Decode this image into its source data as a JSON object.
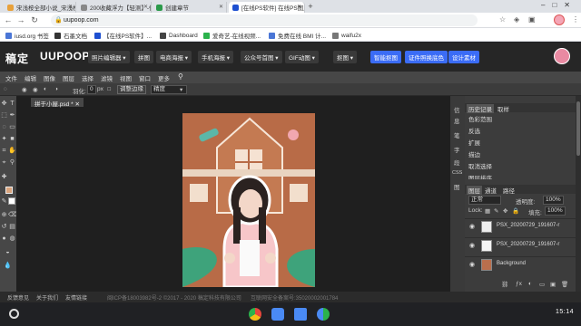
{
  "browser": {
    "tabs": [
      {
        "title": "宋浅桉全部小说_宋浅桉作品全集",
        "favicon_color": "#e8a13a"
      },
      {
        "title": "200收藏浮力【轻测】-他免…",
        "favicon_color": "#888888"
      },
      {
        "title": "创建章节",
        "favicon_color": "#2b9a4a"
      },
      {
        "title": "[在线PS软件] 在线PS图片",
        "favicon_color": "#1d4fd0",
        "active": true
      }
    ],
    "new_tab": "+",
    "url": "uupoop.com",
    "bookmarks": [
      {
        "label": "iusd.org 书签",
        "color": "#4a76d6"
      },
      {
        "label": "石墨文档",
        "color": "#333333"
      },
      {
        "label": "【在线PS软件】...",
        "color": "#1d4fd0"
      },
      {
        "label": "Dashboard",
        "color": "#444444"
      },
      {
        "label": "爱奇艺-在线视频...",
        "color": "#2bb24c"
      },
      {
        "label": "免费在线 BMI 计...",
        "color": "#4a76d6"
      },
      {
        "label": "waifu2x",
        "color": "#777777"
      }
    ]
  },
  "app": {
    "logo_cn": "稿定",
    "logo_en": "UUPOOP",
    "nav": [
      {
        "label": "照片编辑器 ▾",
        "style": "dark"
      },
      {
        "label": "拼图",
        "style": "dark"
      },
      {
        "label": "电商海报 ▾",
        "style": "dark"
      },
      {
        "label": "手机海报 ▾",
        "style": "dark"
      },
      {
        "label": "公众号首图 ▾",
        "style": "dark"
      },
      {
        "label": "GIF动图 ▾",
        "style": "dark"
      },
      {
        "label": "抠图 ▾",
        "style": "dark"
      },
      {
        "label": "智能抠图",
        "style": "blue"
      },
      {
        "label": "证件照换底色",
        "style": "blue"
      },
      {
        "label": "设计素材",
        "style": "blue"
      }
    ],
    "menu": [
      "文件",
      "编辑",
      "图像",
      "图层",
      "选择",
      "滤镜",
      "视图",
      "窗口",
      "更多"
    ],
    "options": {
      "feather_label": "羽化:",
      "feather_value": "0",
      "feather_unit": "px",
      "refine_edge": "调整边缘",
      "mode": "精度"
    },
    "document_tab": "拼于小屋.psd *",
    "side_labels": [
      "信",
      "息",
      "笔",
      "字",
      "段",
      "CSS",
      "图"
    ],
    "history": {
      "tabs": [
        "历史记录",
        "取样"
      ],
      "items": [
        "色彩范围",
        "反选",
        "扩展",
        "描边",
        "取消选择",
        "图层排序"
      ]
    },
    "layers": {
      "tabs": [
        "图层",
        "通道",
        "路径"
      ],
      "blend_mode": "正常",
      "opacity_label": "透明度:",
      "opacity_value": "100%",
      "lock_label": "Lock:",
      "fill_label": "填充:",
      "fill_value": "100%",
      "items": [
        {
          "name": "PSX_20200729_191607-r",
          "thumb": "#eeeeee"
        },
        {
          "name": "PSX_20200729_191607-r",
          "thumb": "#f5f5f5"
        },
        {
          "name": "Background",
          "thumb": "#b96f4d"
        }
      ]
    }
  },
  "footer": {
    "links": [
      "反馈意见",
      "关于我们",
      "友情链接"
    ],
    "icp": "闽ICP备18003982号-2 ©2017 - 2020 稿定科技有限公司",
    "police": "互联网安全备案号:35020002001784"
  },
  "taskbar": {
    "time": "15:14",
    "apps": [
      {
        "name": "chrome-icon",
        "color": "#e8453c"
      },
      {
        "name": "files-icon",
        "color": "#4a8af4"
      },
      {
        "name": "docs-icon",
        "color": "#4a8af4"
      },
      {
        "name": "play-store-icon",
        "color": "#2bb24c"
      }
    ]
  }
}
